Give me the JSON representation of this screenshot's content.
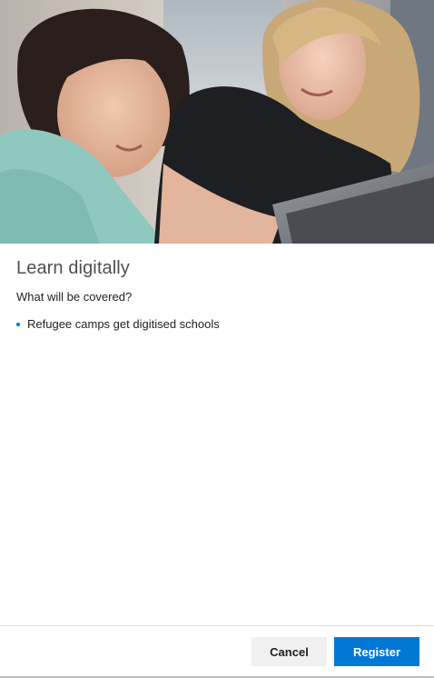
{
  "hero": {
    "image": "girl-and-teacher-with-laptop-photo"
  },
  "content": {
    "title": "Learn digitally",
    "subtitle": "What will be covered?",
    "bullets": [
      "Refugee camps get digitised schools"
    ]
  },
  "footer": {
    "cancel_label": "Cancel",
    "register_label": "Register"
  },
  "colors": {
    "accent": "#0078d4",
    "cancel_bg": "#f0f0f0",
    "title_text": "#505050"
  }
}
